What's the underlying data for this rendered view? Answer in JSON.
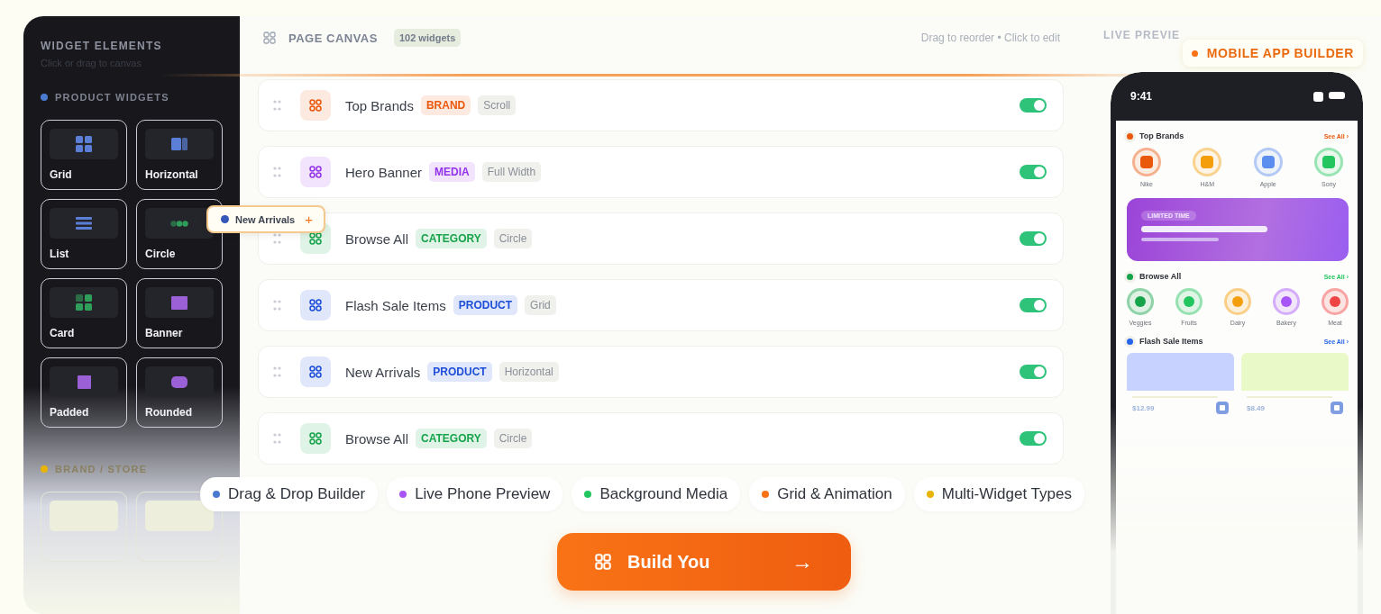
{
  "sidebar": {
    "title": "WIDGET ELEMENTS",
    "subtitle": "Click or drag to canvas",
    "sections": [
      {
        "title": "PRODUCT WIDGETS",
        "color": "#4a7bd0",
        "tiles": [
          {
            "label": "Grid",
            "kind": "grid"
          },
          {
            "label": "Horizontal",
            "kind": "horizontal"
          },
          {
            "label": "List",
            "kind": "list"
          },
          {
            "label": "Circle",
            "kind": "circle"
          },
          {
            "label": "Card",
            "kind": "card"
          },
          {
            "label": "Banner",
            "kind": "banner"
          },
          {
            "label": "Padded",
            "kind": "padded"
          },
          {
            "label": "Rounded",
            "kind": "rounded"
          }
        ]
      },
      {
        "title": "BRAND / STORE",
        "color": "#eab308",
        "tiles": [
          {
            "kind": "blank"
          },
          {
            "kind": "blank"
          }
        ]
      }
    ]
  },
  "canvas": {
    "title": "PAGE CANVAS",
    "count": "102 widgets",
    "hint": "Drag to reorder • Click to edit",
    "rows": [
      {
        "name": "Top Brands",
        "tag": "BRAND",
        "color": "#ea580c",
        "layout": "Scroll",
        "on": true
      },
      {
        "name": "Hero Banner",
        "tag": "MEDIA",
        "color": "#9333ea",
        "layout": "Full Width",
        "on": true
      },
      {
        "name": "Browse All",
        "tag": "CATEGORY",
        "color": "#16a34a",
        "layout": "Circle",
        "on": true
      },
      {
        "name": "Flash Sale Items",
        "tag": "PRODUCT",
        "color": "#1d4ed8",
        "layout": "Grid",
        "on": true
      },
      {
        "name": "New Arrivals",
        "tag": "PRODUCT",
        "color": "#1d4ed8",
        "layout": "Horizontal",
        "on": true
      },
      {
        "name": "Browse All",
        "tag": "CATEGORY",
        "color": "#16a34a",
        "layout": "Circle",
        "on": true
      }
    ]
  },
  "drag_chip": {
    "label": "New Arrivals",
    "icon": "+"
  },
  "preview": {
    "title": "LIVE PREVIE",
    "badge": "MOBILE APP BUILDER",
    "phone": {
      "time": "9:41",
      "brands": {
        "title": "Top Brands",
        "link": "See All ›",
        "items": [
          {
            "label": "Nike",
            "color": "#ea580c"
          },
          {
            "label": "H&M",
            "color": "#f59e0b"
          },
          {
            "label": "Apple",
            "color": "#5b8def"
          },
          {
            "label": "Sony",
            "color": "#22c55e"
          }
        ]
      },
      "banner": {
        "label": "LIMITED TIME"
      },
      "categories": {
        "title": "Browse All",
        "link": "See All ›",
        "items": [
          {
            "label": "Veggies",
            "color": "#16a34a"
          },
          {
            "label": "Fruits",
            "color": "#22c55e"
          },
          {
            "label": "Dairy",
            "color": "#f59e0b"
          },
          {
            "label": "Bakery",
            "color": "#a855f7"
          },
          {
            "label": "Meat",
            "color": "#ef4444"
          }
        ]
      },
      "flash": {
        "title": "Flash Sale Items",
        "link": "See All ›",
        "items": [
          {
            "price": "$12.99",
            "color": "#c7d2fe"
          },
          {
            "price": "$8.49",
            "color": "#e9f9c8"
          }
        ]
      }
    }
  },
  "features": [
    {
      "label": "Drag & Drop Builder",
      "color": "#4a7bd0"
    },
    {
      "label": "Live Phone Preview",
      "color": "#a855f7"
    },
    {
      "label": "Background Media",
      "color": "#22c55e"
    },
    {
      "label": "Grid & Animation",
      "color": "#f97316"
    },
    {
      "label": "Multi-Widget Types",
      "color": "#eab308"
    }
  ],
  "cta": {
    "label": "Build You",
    "arrow": "→"
  }
}
